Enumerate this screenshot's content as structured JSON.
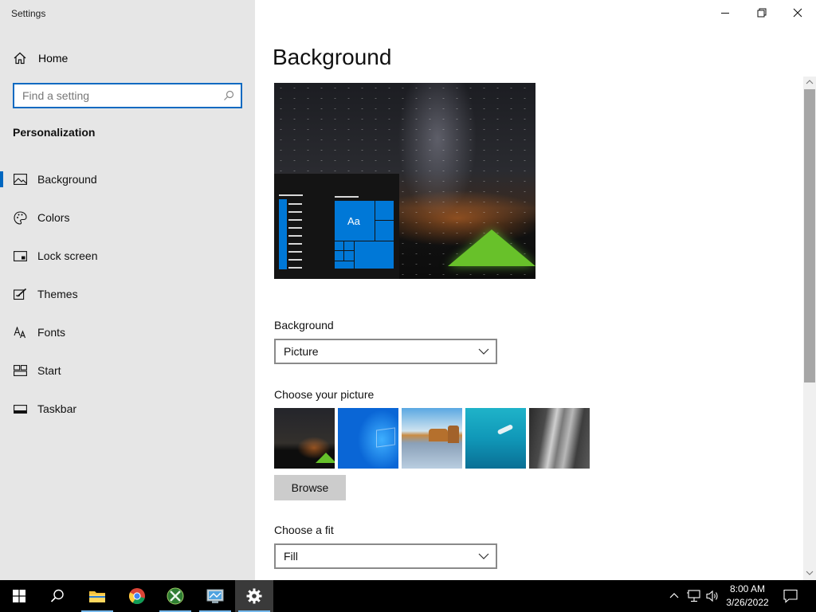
{
  "window": {
    "title": "Settings",
    "controls": {
      "minimize": "minimize-icon",
      "restore": "restore-icon",
      "close": "close-icon"
    }
  },
  "sidebar": {
    "home_label": "Home",
    "search": {
      "placeholder": "Find a setting"
    },
    "section_title": "Personalization",
    "items": [
      {
        "label": "Background",
        "icon": "picture-icon",
        "active": true
      },
      {
        "label": "Colors",
        "icon": "palette-icon"
      },
      {
        "label": "Lock screen",
        "icon": "lock-screen-icon"
      },
      {
        "label": "Themes",
        "icon": "themes-icon"
      },
      {
        "label": "Fonts",
        "icon": "fonts-icon"
      },
      {
        "label": "Start",
        "icon": "start-icon"
      },
      {
        "label": "Taskbar",
        "icon": "taskbar-icon"
      }
    ]
  },
  "main": {
    "title": "Background",
    "preview": {
      "tile_label": "Aa"
    },
    "background_label": "Background",
    "background_value": "Picture",
    "choose_picture_label": "Choose your picture",
    "pictures": [
      "night-sky-tent",
      "windows-blue",
      "beach-rocks",
      "underwater-swimmer",
      "rock-cliff"
    ],
    "browse_label": "Browse",
    "fit_label": "Choose a fit",
    "fit_value": "Fill"
  },
  "taskbar": {
    "apps": [
      "start-icon",
      "search-icon",
      "file-explorer-icon",
      "chrome-icon",
      "xbox-icon",
      "control-panel-icon",
      "settings-icon"
    ],
    "tray_icons": [
      "chevron-up-icon",
      "network-icon",
      "volume-icon"
    ],
    "time": "8:00 AM",
    "date": "3/26/2022",
    "notification_icon": "notification-icon"
  },
  "colors": {
    "accent": "#0078d7",
    "sidebar_bg": "#e6e6e6",
    "taskbar_bg": "#000000"
  }
}
